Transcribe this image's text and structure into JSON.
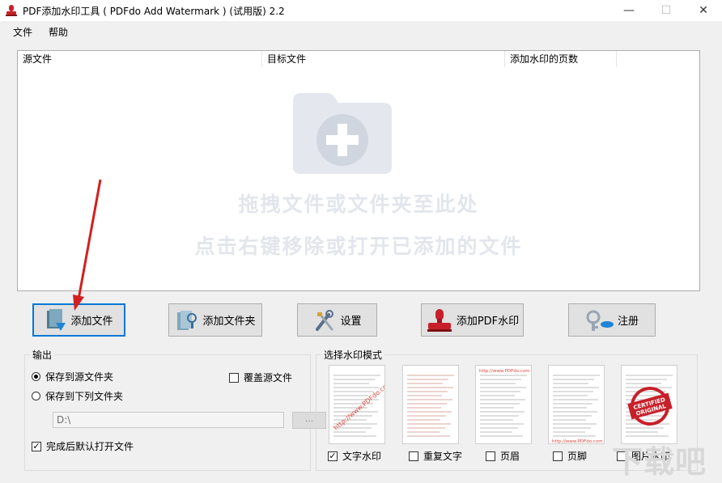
{
  "window": {
    "title": "PDF添加水印工具 ( PDFdo Add Watermark ) (试用版) 2.2",
    "minimize": "—",
    "maximize": "☐",
    "close": "✕"
  },
  "menu": [
    "文件",
    "帮助"
  ],
  "file_list": {
    "columns": [
      "源文件",
      "目标文件",
      "添加水印的页数"
    ],
    "hint_line1": "拖拽文件或文件夹至此处",
    "hint_line2": "点击右键移除或打开已添加的文件"
  },
  "toolbar": {
    "add_file": "添加文件",
    "add_folder": "添加文件夹",
    "settings": "设置",
    "add_watermark": "添加PDF水印",
    "register": "注册"
  },
  "output": {
    "title": "输出",
    "save_to_source": "保存到源文件夹",
    "save_to_folder": "保存到下列文件夹",
    "overwrite": "覆盖源文件",
    "path": "D:\\",
    "browse": "...",
    "open_after": "完成后默认打开文件",
    "save_to_source_selected": true,
    "overwrite_checked": false,
    "open_after_checked": true
  },
  "watermark_mode": {
    "title": "选择水印模式",
    "options": [
      {
        "label": "文字水印",
        "checked": true
      },
      {
        "label": "重复文字",
        "checked": false
      },
      {
        "label": "页眉",
        "checked": false
      },
      {
        "label": "页脚",
        "checked": false
      },
      {
        "label": "图片水印",
        "checked": false
      }
    ],
    "sample_text": "http://www.PDFdo.com",
    "stamp_line1": "CERTIFIED",
    "stamp_line2": "ORIGINAL"
  },
  "brand_watermark": "下载吧",
  "colors": {
    "accent": "#0078d7",
    "arrow": "#d21f1f",
    "stamp": "#c8202a"
  }
}
